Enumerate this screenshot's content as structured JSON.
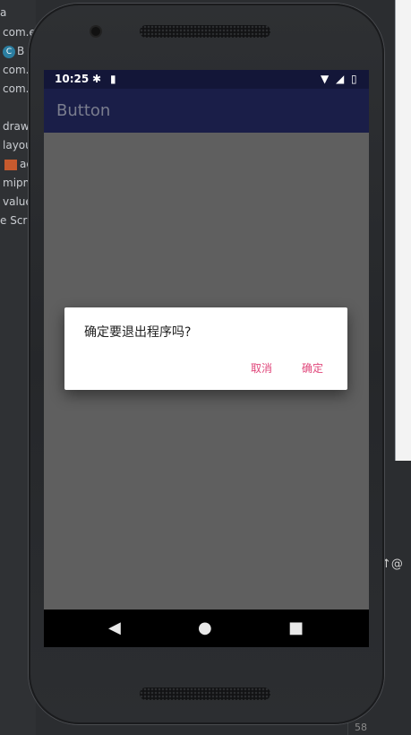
{
  "ide": {
    "items": [
      {
        "label": "a"
      },
      {
        "label": "com.e"
      },
      {
        "label": "B",
        "badge": "C"
      },
      {
        "label": "com."
      },
      {
        "label": "com."
      },
      {
        "label": "draw"
      },
      {
        "label": "layou"
      },
      {
        "label": "ac"
      },
      {
        "label": "mipm"
      },
      {
        "label": "value"
      },
      {
        "label": "e Scrip"
      }
    ],
    "at_symbol": "↑@",
    "line_number": "58"
  },
  "phone": {
    "status": {
      "time": "10:25",
      "icons": [
        "settings-icon",
        "sd-card-icon",
        "wifi-icon",
        "signal-icon",
        "battery-icon"
      ]
    },
    "appbar": {
      "title": "Button"
    },
    "dialog": {
      "message": "确定要退出程序吗?",
      "cancel": "取消",
      "confirm": "确定",
      "accent_color": "#e0467a"
    },
    "navbar": {
      "back": "◀",
      "home": "●",
      "recents": "■"
    }
  }
}
